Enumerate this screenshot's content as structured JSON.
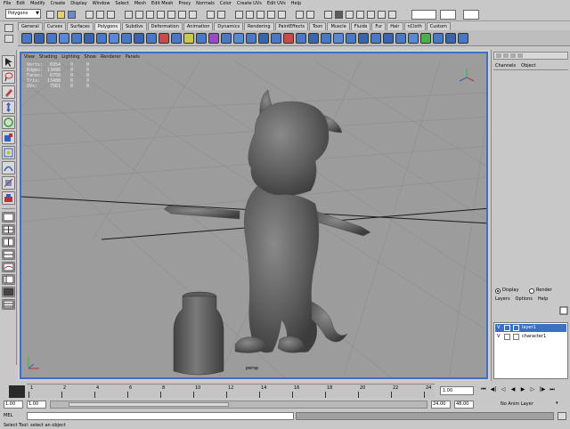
{
  "menubar": {
    "items": [
      "File",
      "Edit",
      "Modify",
      "Create",
      "Display",
      "Window",
      "Select",
      "Mesh",
      "Edit Mesh",
      "Proxy",
      "Normals",
      "Color",
      "Create UVs",
      "Edit UVs",
      "Help"
    ]
  },
  "statusline": {
    "mode": "Polygons"
  },
  "shelf": {
    "tabs": [
      "General",
      "Curves",
      "Surfaces",
      "Polygons",
      "Subdivs",
      "Deformation",
      "Animation",
      "Dynamics",
      "Rendering",
      "PaintEffects",
      "Toon",
      "Muscle",
      "Fluids",
      "Fur",
      "Hair",
      "nCloth",
      "Custom"
    ],
    "active_tab": 3
  },
  "viewport": {
    "menu": [
      "View",
      "Shading",
      "Lighting",
      "Show",
      "Renderer",
      "Panels"
    ],
    "hud": [
      {
        "label": "Verts:",
        "v1": "6954",
        "v2": "0",
        "v3": "0"
      },
      {
        "label": "Edges:",
        "v1": "13496",
        "v2": "0",
        "v3": "0"
      },
      {
        "label": "Faces:",
        "v1": "6750",
        "v2": "0",
        "v3": "0"
      },
      {
        "label": "Tris:",
        "v1": "13480",
        "v2": "0",
        "v3": "0"
      },
      {
        "label": "UVs:",
        "v1": "7561",
        "v2": "0",
        "v3": "0"
      }
    ],
    "camera": "persp"
  },
  "channelbox": {
    "header": [
      "Channels",
      "Object"
    ],
    "layer_mode": [
      "Display",
      "Render"
    ],
    "layer_menu": [
      "Layers",
      "Options",
      "Help"
    ],
    "layers": [
      {
        "v": "V",
        "name": "layer1"
      },
      {
        "v": "V",
        "name": "character1"
      }
    ]
  },
  "timeslider": {
    "ticks": [
      "1",
      "2",
      "4",
      "6",
      "8",
      "10",
      "12",
      "14",
      "16",
      "18",
      "20",
      "22",
      "24"
    ],
    "current_frame": "1.00"
  },
  "rangeslider": {
    "start": "1.00",
    "range_start": "1.00",
    "range_end": "24.00",
    "end": "48.00",
    "anim_layer": "No Anim Layer",
    "char_set": "No Character Set"
  },
  "cmdline": {
    "lang": "MEL",
    "help": "Select Tool: select an object"
  },
  "colors": {
    "viewport_bg": "#9c9c9c",
    "viewport_border": "#3c70c0",
    "ui_bg": "#c8c8c8",
    "highlight": "#3c70c0"
  }
}
